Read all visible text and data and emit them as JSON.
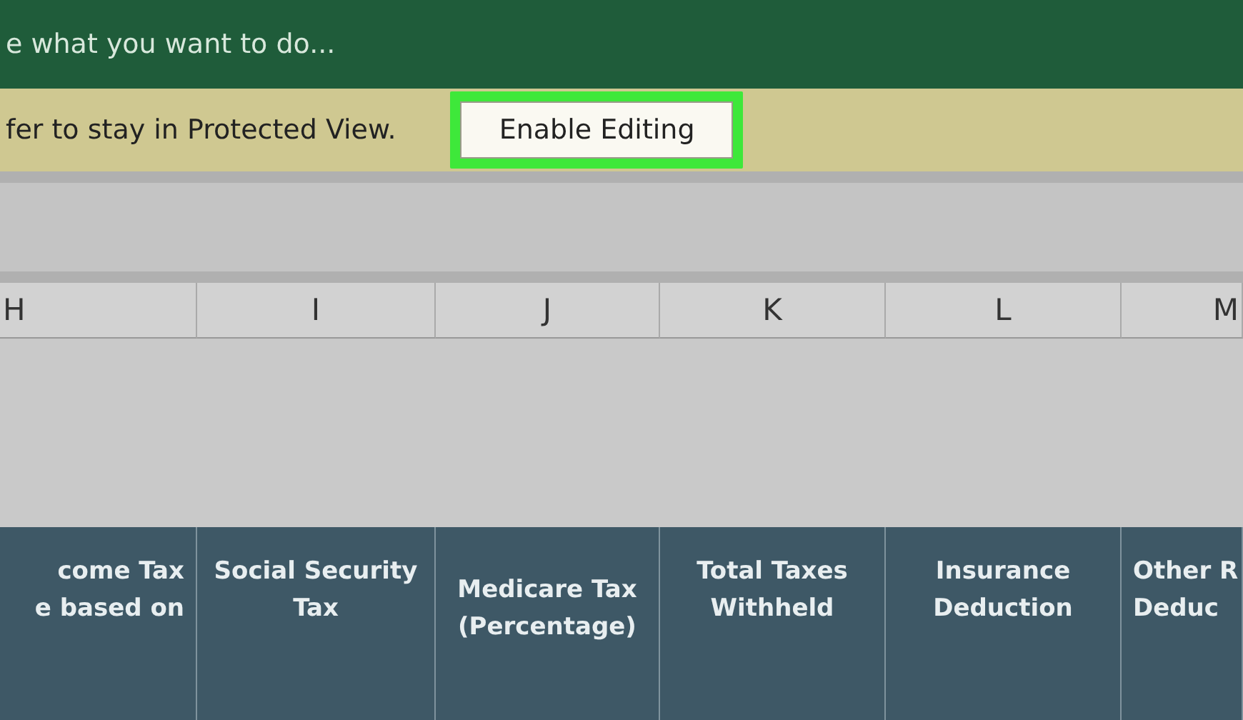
{
  "title_bar": {
    "tell_me": "e what you want to do..."
  },
  "message_bar": {
    "message": "fer to stay in Protected View.",
    "button": "Enable Editing",
    "highlighted": true
  },
  "column_headers": [
    "H",
    "I",
    "J",
    "K",
    "L",
    "M"
  ],
  "header_row": [
    {
      "lines": [
        "come Tax",
        "e based on"
      ]
    },
    {
      "lines": [
        "Social Security",
        "Tax"
      ]
    },
    {
      "lines": [
        "Medicare Tax",
        "(Percentage)"
      ]
    },
    {
      "lines": [
        "Total Taxes",
        "Withheld"
      ]
    },
    {
      "lines": [
        "Insurance",
        "Deduction"
      ]
    },
    {
      "lines": [
        "Other R",
        "Deduc"
      ]
    }
  ]
}
